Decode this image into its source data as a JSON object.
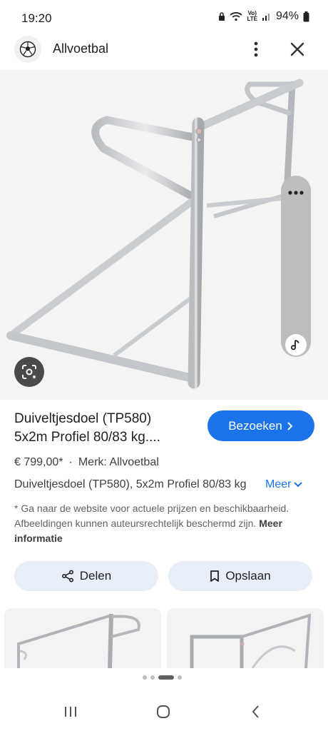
{
  "status": {
    "time": "19:20",
    "network": "LTE",
    "volte": "Vo)",
    "battery": "94%"
  },
  "header": {
    "site_name": "Allvoetbal"
  },
  "product": {
    "title_line1": "Duiveltjesdoel (TP580)",
    "title_line2": "5x2m Profiel 80/83 kg....",
    "visit_label": "Bezoeken",
    "price": "€ 799,00*",
    "separator": "·",
    "brand": "Merk: Allvoetbal",
    "description": "Duiveltjesdoel (TP580), 5x2m Profiel 80/83 kg",
    "more_label": "Meer",
    "disclaimer": "* Ga naar de website voor actuele prijzen en beschikbaarheid. Afbeeldingen kunnen auteursrechtelijk beschermd zijn.",
    "more_info_label": "Meer informatie"
  },
  "actions": {
    "share_label": "Delen",
    "save_label": "Opslaan"
  },
  "icons": {
    "logo": "soccer-ball-icon",
    "menu": "more-vert-icon",
    "close": "close-icon",
    "lens": "lens-icon",
    "share": "share-icon",
    "save": "bookmark-icon"
  },
  "colors": {
    "accent": "#1a73e8",
    "button_bg": "#e8eef8"
  }
}
